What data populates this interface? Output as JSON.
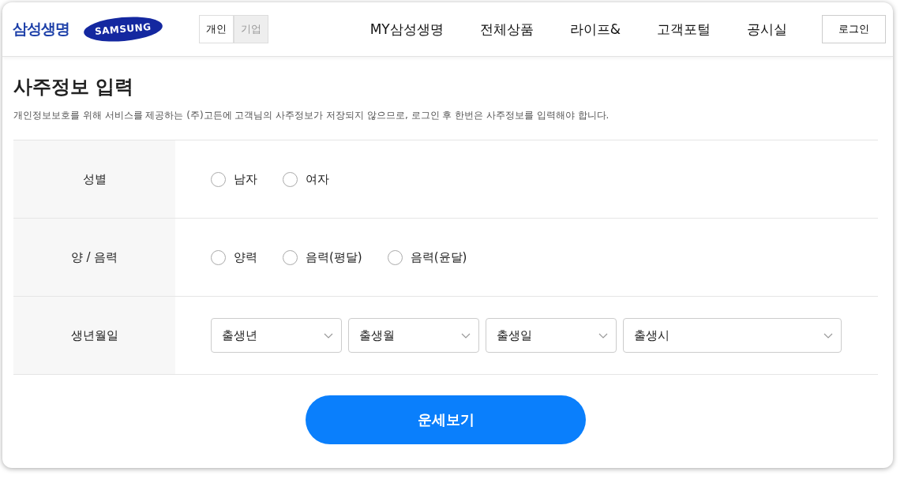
{
  "header": {
    "brand": "삼성생명",
    "logo": "SAMSUNG",
    "segments": [
      {
        "label": "개인",
        "selected": true
      },
      {
        "label": "기업",
        "selected": false
      }
    ],
    "nav": [
      "MY삼성생명",
      "전체상품",
      "라이프&",
      "고객포털",
      "공시실"
    ],
    "login": "로그인"
  },
  "title": "사주정보 입력",
  "notice": "개인정보보호를 위해 서비스를 제공하는 (주)고든에 고객님의 사주정보가 저장되지 않으므로, 로그인 후 한번은 사주정보를 입력해야 합니다.",
  "form": [
    {
      "label": "성별",
      "kind": "radio",
      "options": [
        {
          "label": "남자",
          "selected": false
        },
        {
          "label": "여자",
          "selected": false
        }
      ]
    },
    {
      "label": "양 / 음력",
      "kind": "radio",
      "options": [
        {
          "label": "양력",
          "selected": false
        },
        {
          "label": "음력(평달)",
          "selected": false
        },
        {
          "label": "음력(윤달)",
          "selected": false
        }
      ]
    },
    {
      "label": "생년월일",
      "kind": "select",
      "selects": [
        {
          "placeholder": "출생년"
        },
        {
          "placeholder": "출생월"
        },
        {
          "placeholder": "출생일"
        },
        {
          "placeholder": "출생시"
        }
      ]
    }
  ],
  "submit": "운세보기"
}
